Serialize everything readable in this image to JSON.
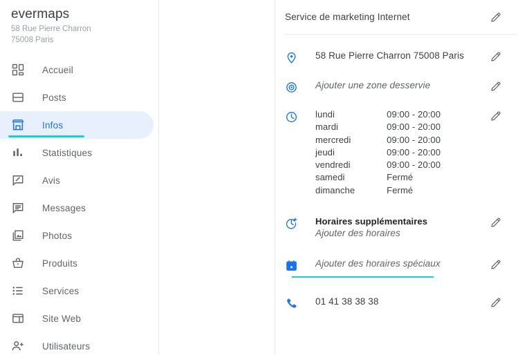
{
  "sidebar": {
    "brand": {
      "name": "evermaps",
      "address_line1": "58 Rue Pierre Charron",
      "address_line2": "75008 Paris"
    },
    "items": [
      {
        "label": "Accueil",
        "icon": "dashboard-icon",
        "selected": false
      },
      {
        "label": "Posts",
        "icon": "posts-icon",
        "selected": false
      },
      {
        "label": "Infos",
        "icon": "storefront-icon",
        "selected": true
      },
      {
        "label": "Statistiques",
        "icon": "bar-chart-icon",
        "selected": false
      },
      {
        "label": "Avis",
        "icon": "review-icon",
        "selected": false
      },
      {
        "label": "Messages",
        "icon": "message-icon",
        "selected": false
      },
      {
        "label": "Photos",
        "icon": "photo-icon",
        "selected": false
      },
      {
        "label": "Produits",
        "icon": "basket-icon",
        "selected": false
      },
      {
        "label": "Services",
        "icon": "list-icon",
        "selected": false
      },
      {
        "label": "Site Web",
        "icon": "website-icon",
        "selected": false
      },
      {
        "label": "Utilisateurs",
        "icon": "person-add-icon",
        "selected": false
      }
    ]
  },
  "info": {
    "category": {
      "text": "Service de marketing Internet",
      "edit_icon": "pencil-icon"
    },
    "address": {
      "icon": "location-pin-icon",
      "text": "58 Rue Pierre Charron 75008 Paris",
      "edit_icon": "pencil-icon"
    },
    "service_area": {
      "icon": "target-pin-icon",
      "placeholder": "Ajouter une zone desservie",
      "edit_icon": "pencil-icon"
    },
    "hours": {
      "icon": "clock-icon",
      "edit_icon": "pencil-icon",
      "rows": [
        {
          "day": "lundi",
          "time": "09:00 - 20:00"
        },
        {
          "day": "mardi",
          "time": "09:00 - 20:00"
        },
        {
          "day": "mercredi",
          "time": "09:00 - 20:00"
        },
        {
          "day": "jeudi",
          "time": "09:00 - 20:00"
        },
        {
          "day": "vendredi",
          "time": "09:00 - 20:00"
        },
        {
          "day": "samedi",
          "time": "Fermé"
        },
        {
          "day": "dimanche",
          "time": "Fermé"
        }
      ]
    },
    "extra_hours": {
      "icon": "clock-plus-icon",
      "title": "Horaires supplémentaires",
      "placeholder": "Ajouter des horaires",
      "edit_icon": "pencil-icon"
    },
    "special_hours": {
      "icon": "calendar-icon",
      "placeholder": "Ajouter des horaires spéciaux",
      "edit_icon": "pencil-icon",
      "focused": true
    },
    "phone": {
      "icon": "phone-icon",
      "text": "01 41 38 38 38",
      "edit_icon": "pencil-icon"
    }
  },
  "colors": {
    "accent_blue": "#1a73e8",
    "accent_teal": "#1ad0cf",
    "selected_bg": "#e8f0fe",
    "text_primary": "#3c4043",
    "text_muted": "#5f6368",
    "divider": "#e8eaed"
  }
}
